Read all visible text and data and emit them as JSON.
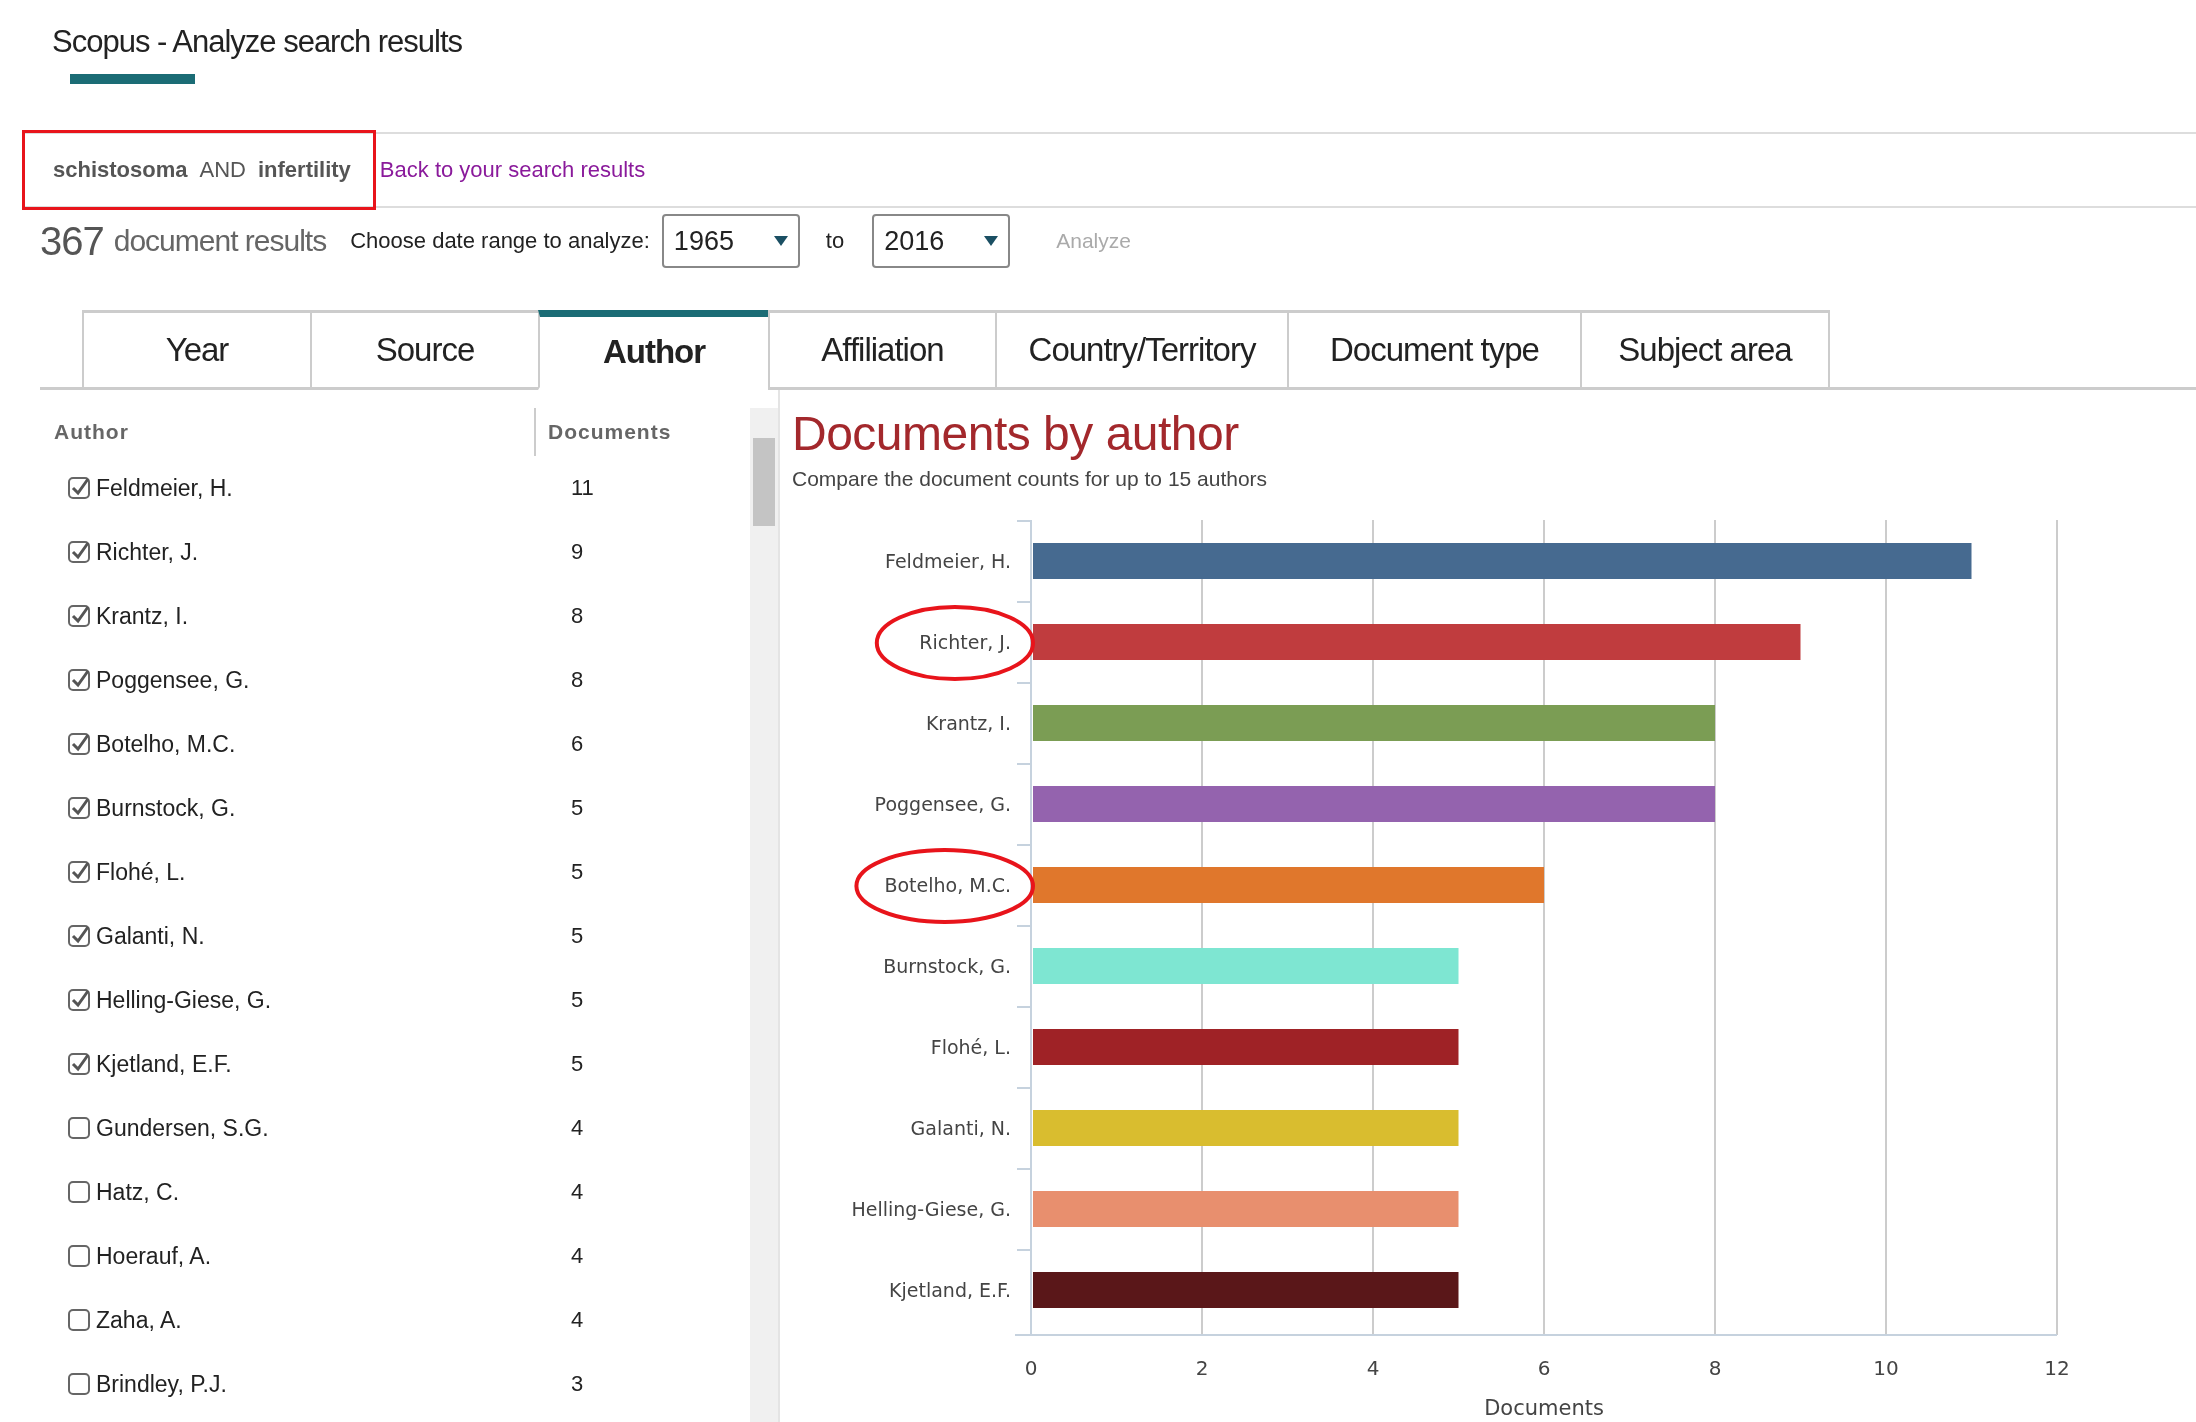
{
  "header": {
    "title": "Scopus - Analyze search results"
  },
  "query": {
    "highlighted": true,
    "terms": [
      {
        "text": "schistosoma",
        "kind": "term"
      },
      {
        "text": "AND",
        "kind": "operator"
      },
      {
        "text": "infertility",
        "kind": "term"
      }
    ],
    "back_link": "Back to your search results"
  },
  "summary": {
    "count": "367",
    "label": "document results",
    "range_label": "Choose date range to analyze:",
    "from": "1965",
    "to_label": "to",
    "to": "2016",
    "analyze": {
      "label": "Analyze",
      "disabled": true
    }
  },
  "tabs": [
    {
      "label": "Year",
      "selected": false
    },
    {
      "label": "Source",
      "selected": false
    },
    {
      "label": "Author",
      "selected": true
    },
    {
      "label": "Affiliation",
      "selected": false
    },
    {
      "label": "Country/Territory",
      "selected": false
    },
    {
      "label": "Document type",
      "selected": false
    },
    {
      "label": "Subject area",
      "selected": false
    }
  ],
  "author_list": {
    "columns": [
      "Author",
      "Documents"
    ],
    "rows": [
      {
        "name": "Feldmeier, H.",
        "documents": "11",
        "checked": true
      },
      {
        "name": "Richter, J.",
        "documents": "9",
        "checked": true
      },
      {
        "name": "Krantz, I.",
        "documents": "8",
        "checked": true
      },
      {
        "name": "Poggensee, G.",
        "documents": "8",
        "checked": true
      },
      {
        "name": "Botelho, M.C.",
        "documents": "6",
        "checked": true
      },
      {
        "name": "Burnstock, G.",
        "documents": "5",
        "checked": true
      },
      {
        "name": "Flohé, L.",
        "documents": "5",
        "checked": true
      },
      {
        "name": "Galanti, N.",
        "documents": "5",
        "checked": true
      },
      {
        "name": "Helling-Giese, G.",
        "documents": "5",
        "checked": true
      },
      {
        "name": "Kjetland, E.F.",
        "documents": "5",
        "checked": true
      },
      {
        "name": "Gundersen, S.G.",
        "documents": "4",
        "checked": false
      },
      {
        "name": "Hatz, C.",
        "documents": "4",
        "checked": false
      },
      {
        "name": "Hoerauf, A.",
        "documents": "4",
        "checked": false
      },
      {
        "name": "Zaha, A.",
        "documents": "4",
        "checked": false
      },
      {
        "name": "Brindley, P.J.",
        "documents": "3",
        "checked": false
      }
    ]
  },
  "chart": {
    "title": "Documents by author",
    "subtitle": "Compare the document counts for up to 15 authors",
    "circled": [
      false,
      true,
      false,
      false,
      true,
      false,
      false,
      false,
      false,
      false
    ],
    "chart_data": {
      "type": "bar",
      "orientation": "horizontal",
      "grid": true,
      "xlabel": "Documents",
      "xlim": [
        0,
        12
      ],
      "xticks": [
        0,
        2,
        4,
        6,
        8,
        10,
        12
      ],
      "categories": [
        "Feldmeier, H.",
        "Richter, J.",
        "Krantz, I.",
        "Poggensee, G.",
        "Botelho, M.C.",
        "Burnstock, G.",
        "Flohé, L.",
        "Galanti, N.",
        "Helling-Giese, G.",
        "Kjetland, E.F."
      ],
      "values": [
        11,
        9,
        8,
        8,
        6,
        5,
        5,
        5,
        5,
        5
      ],
      "colors": [
        "#466a90",
        "#c03c3e",
        "#7b9d54",
        "#9463ae",
        "#e0772c",
        "#7ee6d2",
        "#9f2226",
        "#d9bd2f",
        "#e88f6e",
        "#5a1719"
      ]
    }
  }
}
